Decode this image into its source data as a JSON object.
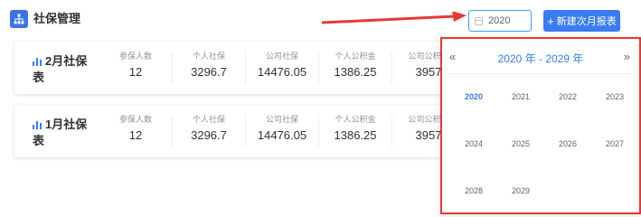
{
  "header": {
    "title": "社保管理",
    "year_value": "2020",
    "new_button_label": "新建次月报表"
  },
  "cards": [
    {
      "title": "2月社保表",
      "stats": [
        {
          "label": "参保人数",
          "value": "12"
        },
        {
          "label": "个人社保",
          "value": "3296.7"
        },
        {
          "label": "公司社保",
          "value": "14476.05"
        },
        {
          "label": "个人公积金",
          "value": "1386.25"
        },
        {
          "label": "公司公积金",
          "value": "3957"
        }
      ]
    },
    {
      "title": "1月社保表",
      "stats": [
        {
          "label": "参保人数",
          "value": "12"
        },
        {
          "label": "个人社保",
          "value": "3296.7"
        },
        {
          "label": "公司社保",
          "value": "14476.05"
        },
        {
          "label": "个人公积金",
          "value": "1386.25"
        },
        {
          "label": "公司公积金",
          "value": "3957"
        }
      ]
    }
  ],
  "year_picker": {
    "prev": "«",
    "next": "»",
    "range_label": "2020 年 - 2029 年",
    "years": [
      "2020",
      "2021",
      "2022",
      "2023",
      "2024",
      "2025",
      "2026",
      "2027",
      "2028",
      "2029"
    ],
    "selected": "2020"
  },
  "colors": {
    "accent": "#3a7cf0",
    "highlight_border": "#e53935",
    "arrow": "#e53935"
  },
  "icons": {
    "header": "sitemap-icon",
    "card": "bar-chart-icon",
    "input": "calendar-icon"
  }
}
